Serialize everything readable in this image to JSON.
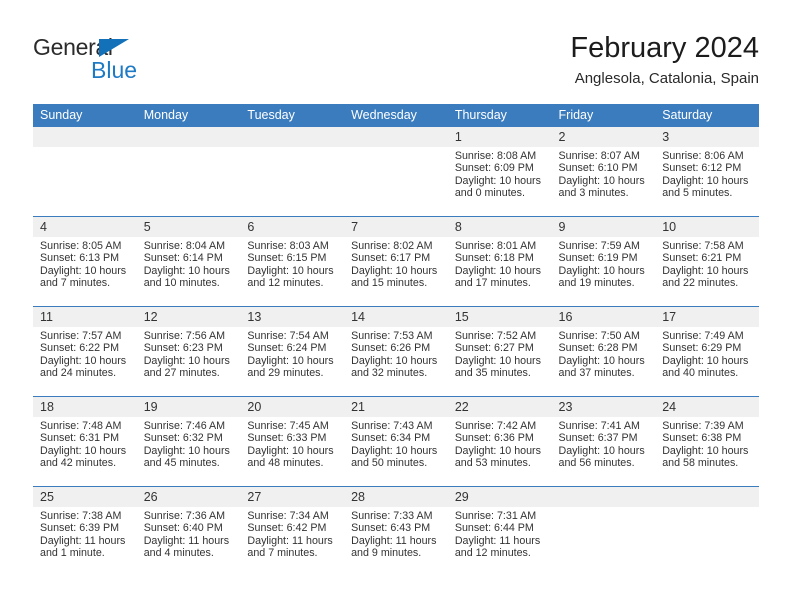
{
  "brand": {
    "name_part1": "General",
    "name_part2": "Blue",
    "triangle_color": "#1271b8",
    "blue_color": "#1e7ac4"
  },
  "header": {
    "month_title": "February 2024",
    "location": "Anglesola, Catalonia, Spain"
  },
  "theme": {
    "header_blue": "#3a7cbe",
    "daynum_bg": "#f0f0f0",
    "text": "#333333"
  },
  "weekday_headers": [
    "Sunday",
    "Monday",
    "Tuesday",
    "Wednesday",
    "Thursday",
    "Friday",
    "Saturday"
  ],
  "weeks": [
    [
      {
        "day": "",
        "sunrise": "",
        "sunset": "",
        "daylight1": "",
        "daylight2": ""
      },
      {
        "day": "",
        "sunrise": "",
        "sunset": "",
        "daylight1": "",
        "daylight2": ""
      },
      {
        "day": "",
        "sunrise": "",
        "sunset": "",
        "daylight1": "",
        "daylight2": ""
      },
      {
        "day": "",
        "sunrise": "",
        "sunset": "",
        "daylight1": "",
        "daylight2": ""
      },
      {
        "day": "1",
        "sunrise": "Sunrise: 8:08 AM",
        "sunset": "Sunset: 6:09 PM",
        "daylight1": "Daylight: 10 hours",
        "daylight2": "and 0 minutes."
      },
      {
        "day": "2",
        "sunrise": "Sunrise: 8:07 AM",
        "sunset": "Sunset: 6:10 PM",
        "daylight1": "Daylight: 10 hours",
        "daylight2": "and 3 minutes."
      },
      {
        "day": "3",
        "sunrise": "Sunrise: 8:06 AM",
        "sunset": "Sunset: 6:12 PM",
        "daylight1": "Daylight: 10 hours",
        "daylight2": "and 5 minutes."
      }
    ],
    [
      {
        "day": "4",
        "sunrise": "Sunrise: 8:05 AM",
        "sunset": "Sunset: 6:13 PM",
        "daylight1": "Daylight: 10 hours",
        "daylight2": "and 7 minutes."
      },
      {
        "day": "5",
        "sunrise": "Sunrise: 8:04 AM",
        "sunset": "Sunset: 6:14 PM",
        "daylight1": "Daylight: 10 hours",
        "daylight2": "and 10 minutes."
      },
      {
        "day": "6",
        "sunrise": "Sunrise: 8:03 AM",
        "sunset": "Sunset: 6:15 PM",
        "daylight1": "Daylight: 10 hours",
        "daylight2": "and 12 minutes."
      },
      {
        "day": "7",
        "sunrise": "Sunrise: 8:02 AM",
        "sunset": "Sunset: 6:17 PM",
        "daylight1": "Daylight: 10 hours",
        "daylight2": "and 15 minutes."
      },
      {
        "day": "8",
        "sunrise": "Sunrise: 8:01 AM",
        "sunset": "Sunset: 6:18 PM",
        "daylight1": "Daylight: 10 hours",
        "daylight2": "and 17 minutes."
      },
      {
        "day": "9",
        "sunrise": "Sunrise: 7:59 AM",
        "sunset": "Sunset: 6:19 PM",
        "daylight1": "Daylight: 10 hours",
        "daylight2": "and 19 minutes."
      },
      {
        "day": "10",
        "sunrise": "Sunrise: 7:58 AM",
        "sunset": "Sunset: 6:21 PM",
        "daylight1": "Daylight: 10 hours",
        "daylight2": "and 22 minutes."
      }
    ],
    [
      {
        "day": "11",
        "sunrise": "Sunrise: 7:57 AM",
        "sunset": "Sunset: 6:22 PM",
        "daylight1": "Daylight: 10 hours",
        "daylight2": "and 24 minutes."
      },
      {
        "day": "12",
        "sunrise": "Sunrise: 7:56 AM",
        "sunset": "Sunset: 6:23 PM",
        "daylight1": "Daylight: 10 hours",
        "daylight2": "and 27 minutes."
      },
      {
        "day": "13",
        "sunrise": "Sunrise: 7:54 AM",
        "sunset": "Sunset: 6:24 PM",
        "daylight1": "Daylight: 10 hours",
        "daylight2": "and 29 minutes."
      },
      {
        "day": "14",
        "sunrise": "Sunrise: 7:53 AM",
        "sunset": "Sunset: 6:26 PM",
        "daylight1": "Daylight: 10 hours",
        "daylight2": "and 32 minutes."
      },
      {
        "day": "15",
        "sunrise": "Sunrise: 7:52 AM",
        "sunset": "Sunset: 6:27 PM",
        "daylight1": "Daylight: 10 hours",
        "daylight2": "and 35 minutes."
      },
      {
        "day": "16",
        "sunrise": "Sunrise: 7:50 AM",
        "sunset": "Sunset: 6:28 PM",
        "daylight1": "Daylight: 10 hours",
        "daylight2": "and 37 minutes."
      },
      {
        "day": "17",
        "sunrise": "Sunrise: 7:49 AM",
        "sunset": "Sunset: 6:29 PM",
        "daylight1": "Daylight: 10 hours",
        "daylight2": "and 40 minutes."
      }
    ],
    [
      {
        "day": "18",
        "sunrise": "Sunrise: 7:48 AM",
        "sunset": "Sunset: 6:31 PM",
        "daylight1": "Daylight: 10 hours",
        "daylight2": "and 42 minutes."
      },
      {
        "day": "19",
        "sunrise": "Sunrise: 7:46 AM",
        "sunset": "Sunset: 6:32 PM",
        "daylight1": "Daylight: 10 hours",
        "daylight2": "and 45 minutes."
      },
      {
        "day": "20",
        "sunrise": "Sunrise: 7:45 AM",
        "sunset": "Sunset: 6:33 PM",
        "daylight1": "Daylight: 10 hours",
        "daylight2": "and 48 minutes."
      },
      {
        "day": "21",
        "sunrise": "Sunrise: 7:43 AM",
        "sunset": "Sunset: 6:34 PM",
        "daylight1": "Daylight: 10 hours",
        "daylight2": "and 50 minutes."
      },
      {
        "day": "22",
        "sunrise": "Sunrise: 7:42 AM",
        "sunset": "Sunset: 6:36 PM",
        "daylight1": "Daylight: 10 hours",
        "daylight2": "and 53 minutes."
      },
      {
        "day": "23",
        "sunrise": "Sunrise: 7:41 AM",
        "sunset": "Sunset: 6:37 PM",
        "daylight1": "Daylight: 10 hours",
        "daylight2": "and 56 minutes."
      },
      {
        "day": "24",
        "sunrise": "Sunrise: 7:39 AM",
        "sunset": "Sunset: 6:38 PM",
        "daylight1": "Daylight: 10 hours",
        "daylight2": "and 58 minutes."
      }
    ],
    [
      {
        "day": "25",
        "sunrise": "Sunrise: 7:38 AM",
        "sunset": "Sunset: 6:39 PM",
        "daylight1": "Daylight: 11 hours",
        "daylight2": "and 1 minute."
      },
      {
        "day": "26",
        "sunrise": "Sunrise: 7:36 AM",
        "sunset": "Sunset: 6:40 PM",
        "daylight1": "Daylight: 11 hours",
        "daylight2": "and 4 minutes."
      },
      {
        "day": "27",
        "sunrise": "Sunrise: 7:34 AM",
        "sunset": "Sunset: 6:42 PM",
        "daylight1": "Daylight: 11 hours",
        "daylight2": "and 7 minutes."
      },
      {
        "day": "28",
        "sunrise": "Sunrise: 7:33 AM",
        "sunset": "Sunset: 6:43 PM",
        "daylight1": "Daylight: 11 hours",
        "daylight2": "and 9 minutes."
      },
      {
        "day": "29",
        "sunrise": "Sunrise: 7:31 AM",
        "sunset": "Sunset: 6:44 PM",
        "daylight1": "Daylight: 11 hours",
        "daylight2": "and 12 minutes."
      },
      {
        "day": "",
        "sunrise": "",
        "sunset": "",
        "daylight1": "",
        "daylight2": ""
      },
      {
        "day": "",
        "sunrise": "",
        "sunset": "",
        "daylight1": "",
        "daylight2": ""
      }
    ]
  ]
}
